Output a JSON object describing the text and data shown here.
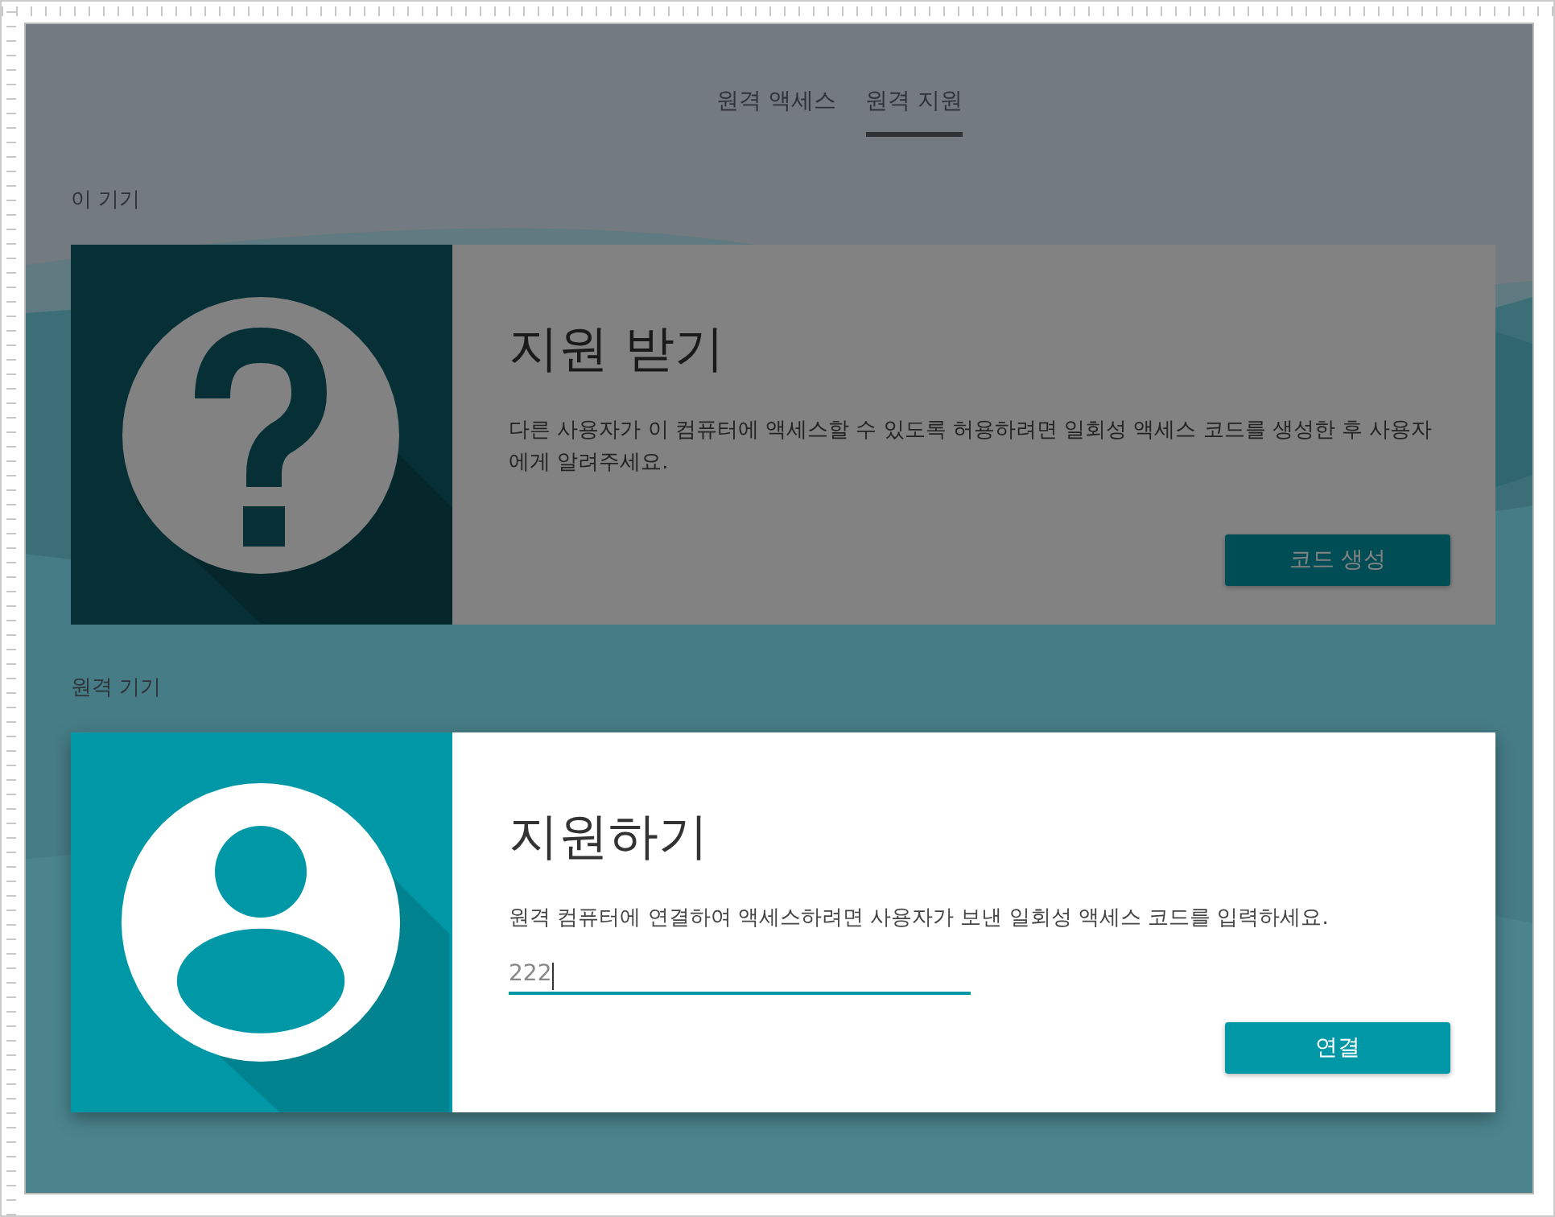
{
  "tabs": [
    {
      "label": "원격 액세스",
      "selected": false
    },
    {
      "label": "원격 지원",
      "selected": true
    }
  ],
  "sections": [
    {
      "heading": "이 기기",
      "card": {
        "kind": "get-support",
        "highlighted": false,
        "title": "지원 받기",
        "description": "다른 사용자가 이 컴퓨터에 액세스할 수 있도록 허용하려면 일회성 액세스 코드를 생성한 후 사용자에게 알려주세요.",
        "button": "코드 생성"
      }
    },
    {
      "heading": "원격 기기",
      "card": {
        "kind": "give-support",
        "highlighted": true,
        "title": "지원하기",
        "description": "원격 컴퓨터에 연결하여 액세스하려면 사용자가 보낸 일회성 액세스 코드를 입력하세요.",
        "input": {
          "value": "222",
          "focused": true
        },
        "button": "연결"
      }
    }
  ]
}
